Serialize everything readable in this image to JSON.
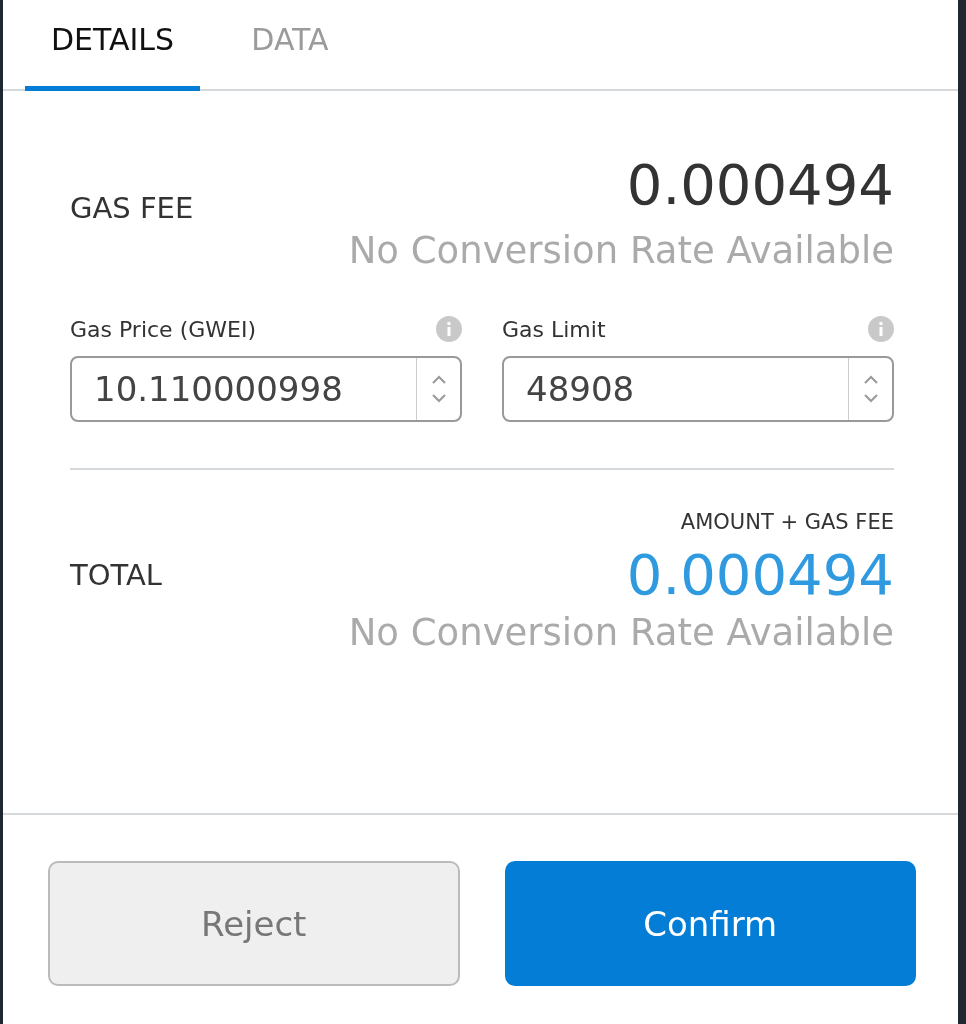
{
  "tabs": [
    {
      "label": "DETAILS",
      "selected": true
    },
    {
      "label": "DATA",
      "selected": false
    }
  ],
  "gas_fee": {
    "label": "GAS FEE",
    "value": "0.000494",
    "conversion": "No Conversion Rate Available"
  },
  "fields": [
    {
      "label": "Gas Price (GWEI)",
      "value": "10.110000998"
    },
    {
      "label": "Gas Limit",
      "value": "48908"
    }
  ],
  "total": {
    "caption": "AMOUNT + GAS FEE",
    "label": "TOTAL",
    "value": "0.000494",
    "conversion": "No Conversion Rate Available"
  },
  "buttons": [
    {
      "label": "Reject",
      "kind": "secondary"
    },
    {
      "label": "Confirm",
      "kind": "primary"
    }
  ]
}
